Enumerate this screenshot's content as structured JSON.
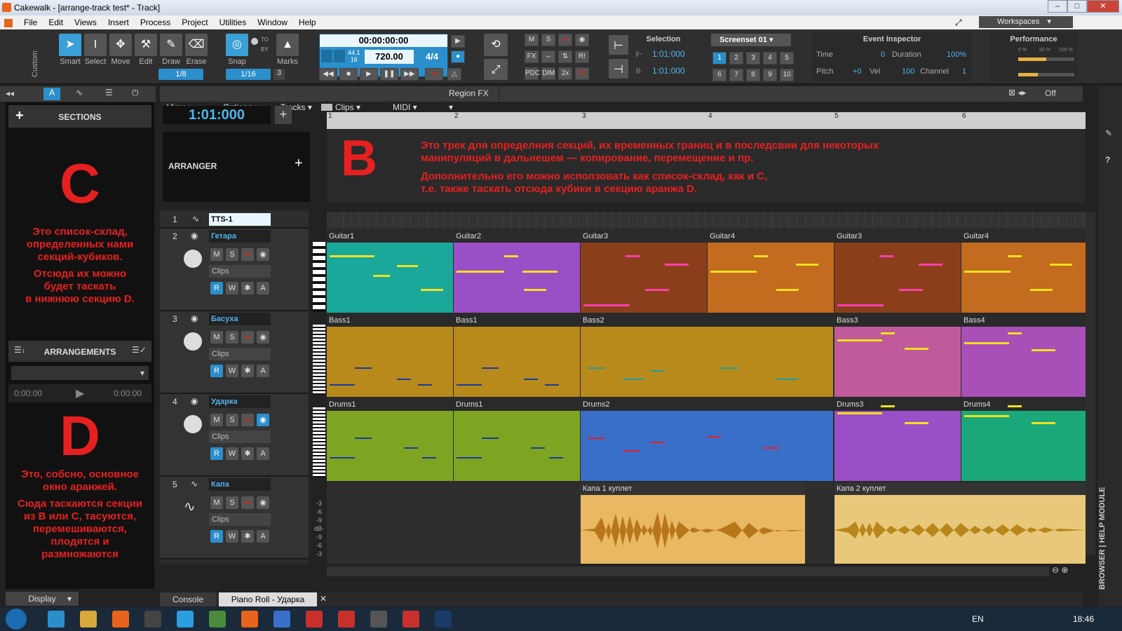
{
  "window": {
    "title": "Cakewalk - [arrange-track test* - Track]"
  },
  "menu": [
    "File",
    "Edit",
    "Views",
    "Insert",
    "Process",
    "Project",
    "Utilities",
    "Window",
    "Help"
  ],
  "workspaces": "Workspaces",
  "tools": [
    {
      "label": "Smart",
      "icon": "pointer-icon"
    },
    {
      "label": "Select",
      "icon": "i-beam-icon"
    },
    {
      "label": "Move",
      "icon": "move-icon"
    },
    {
      "label": "Edit",
      "icon": "edit-icon"
    },
    {
      "label": "Draw",
      "icon": "pencil-icon"
    },
    {
      "label": "Erase",
      "icon": "eraser-icon"
    }
  ],
  "custom_label": "Custom",
  "snap": {
    "label": "Snap",
    "value": "1/16",
    "value2": "1/8",
    "to": "TO",
    "by": "BY",
    "marks": "Marks",
    "num": "3"
  },
  "transport": {
    "time": "00:00:00:00",
    "sample_rate": "44.1",
    "bit": "16",
    "tempo": "720.00",
    "meter": "4/4"
  },
  "selection": {
    "title": "Selection",
    "start": "1:01:000",
    "end": "1:01:000"
  },
  "screenset": {
    "title": "Screenset 01",
    "buttons": [
      "1",
      "2",
      "3",
      "4",
      "5",
      "6",
      "7",
      "8",
      "9",
      "10"
    ]
  },
  "inspector": {
    "title": "Event Inspector",
    "time_label": "Time",
    "time": "0",
    "duration_label": "Duration",
    "duration": "100%",
    "pitch_label": "Pitch",
    "pitch": "+0",
    "vel_label": "Vel",
    "vel": "100",
    "channel_label": "Channel",
    "channel": "1"
  },
  "performance": {
    "title": "Performance",
    "p1": "0 %",
    "p2": "50 %",
    "p3": "100 %"
  },
  "sections": {
    "title": "SECTIONS",
    "letter_c": "C",
    "text_c": [
      "Это список-склад,",
      "определенных нами",
      "секций-кубиков.",
      "Отсюда их можно",
      "будет таскать",
      "в нижнюю секцию D."
    ],
    "arrangements_title": "ARRANGEMENTS",
    "time_start": "0:00:00",
    "time_end": "0:00:00",
    "letter_d": "D",
    "text_d": [
      "Это, собсно, основное",
      "окно аранжей.",
      "Сюда таскаются секции",
      "из B или C, тасуются,",
      "перемешиваются,",
      "плодятся и",
      "размножаются"
    ],
    "display": "Display"
  },
  "viewbar": [
    "View",
    "Options",
    "Tracks",
    "Clips",
    "MIDI",
    "Region FX"
  ],
  "viewbar_off": "Off",
  "now_time": "1:01:000",
  "arranger": {
    "title": "ARRANGER",
    "letter_b": "B",
    "text_b1": [
      "Это  трек для определния секций, их временных границ и в последсвии для некоторых",
      "манипуляций в дальнешем — копирование, перемещение и пр."
    ],
    "text_b2": [
      "Дополнительно его можно исползовать как список-склад, как и С,",
      "т.е. также таскать отсюда кубики в секцию аранжа D."
    ]
  },
  "ruler": [
    "1",
    "2",
    "3",
    "4",
    "5",
    "6"
  ],
  "tracks": [
    {
      "num": "1",
      "name": "TTS-1"
    },
    {
      "num": "2",
      "name": "Гетара",
      "clips": "Clips"
    },
    {
      "num": "3",
      "name": "Басуха",
      "clips": "Clips"
    },
    {
      "num": "4",
      "name": "Ударка",
      "clips": "Clips"
    },
    {
      "num": "5",
      "name": "Капа",
      "clips": "Clips"
    }
  ],
  "track_buttons": {
    "m": "M",
    "s": "S",
    "r": "R",
    "w": "W",
    "a": "A"
  },
  "lanes": {
    "guitar": [
      "Guitar1",
      "Guitar2",
      "Guitar3",
      "Guitar4",
      "Guitar3",
      "Guitar4"
    ],
    "bass": [
      "Bass1",
      "Bass1",
      "Bass2",
      "Bass3",
      "Bass4"
    ],
    "drums": [
      "Drums1",
      "Drums1",
      "Drums2",
      "Drums3",
      "Drums4"
    ],
    "vocal": [
      "Капа 1 куплет",
      "Капа 2 куплет"
    ]
  },
  "colors": {
    "guitar": [
      "#1aa89a",
      "#9b4fc7",
      "#8a3f1a",
      "#c36b1e",
      "#8a3f1a",
      "#c36b1e"
    ],
    "bass": [
      "#b88a1c",
      "#b88a1c",
      "#b88a1c",
      "#c05a9a",
      "#a94fb8"
    ],
    "drums": [
      "#7ea522",
      "#7ea522",
      "#3a6fc9",
      "#9b4fc7",
      "#1aa87a"
    ],
    "vocal": [
      "#e8b862",
      "#e8c87a"
    ]
  },
  "db_scale": [
    "-3",
    "-6",
    "-9",
    "dB-",
    "-9",
    "-6",
    "-3"
  ],
  "bottom_tabs": [
    "Console",
    "Piano Roll - Ударка"
  ],
  "right_sidebar": "BROWSER | HELP MODULE",
  "taskbar": {
    "lang": "EN",
    "clock": "18:46"
  }
}
